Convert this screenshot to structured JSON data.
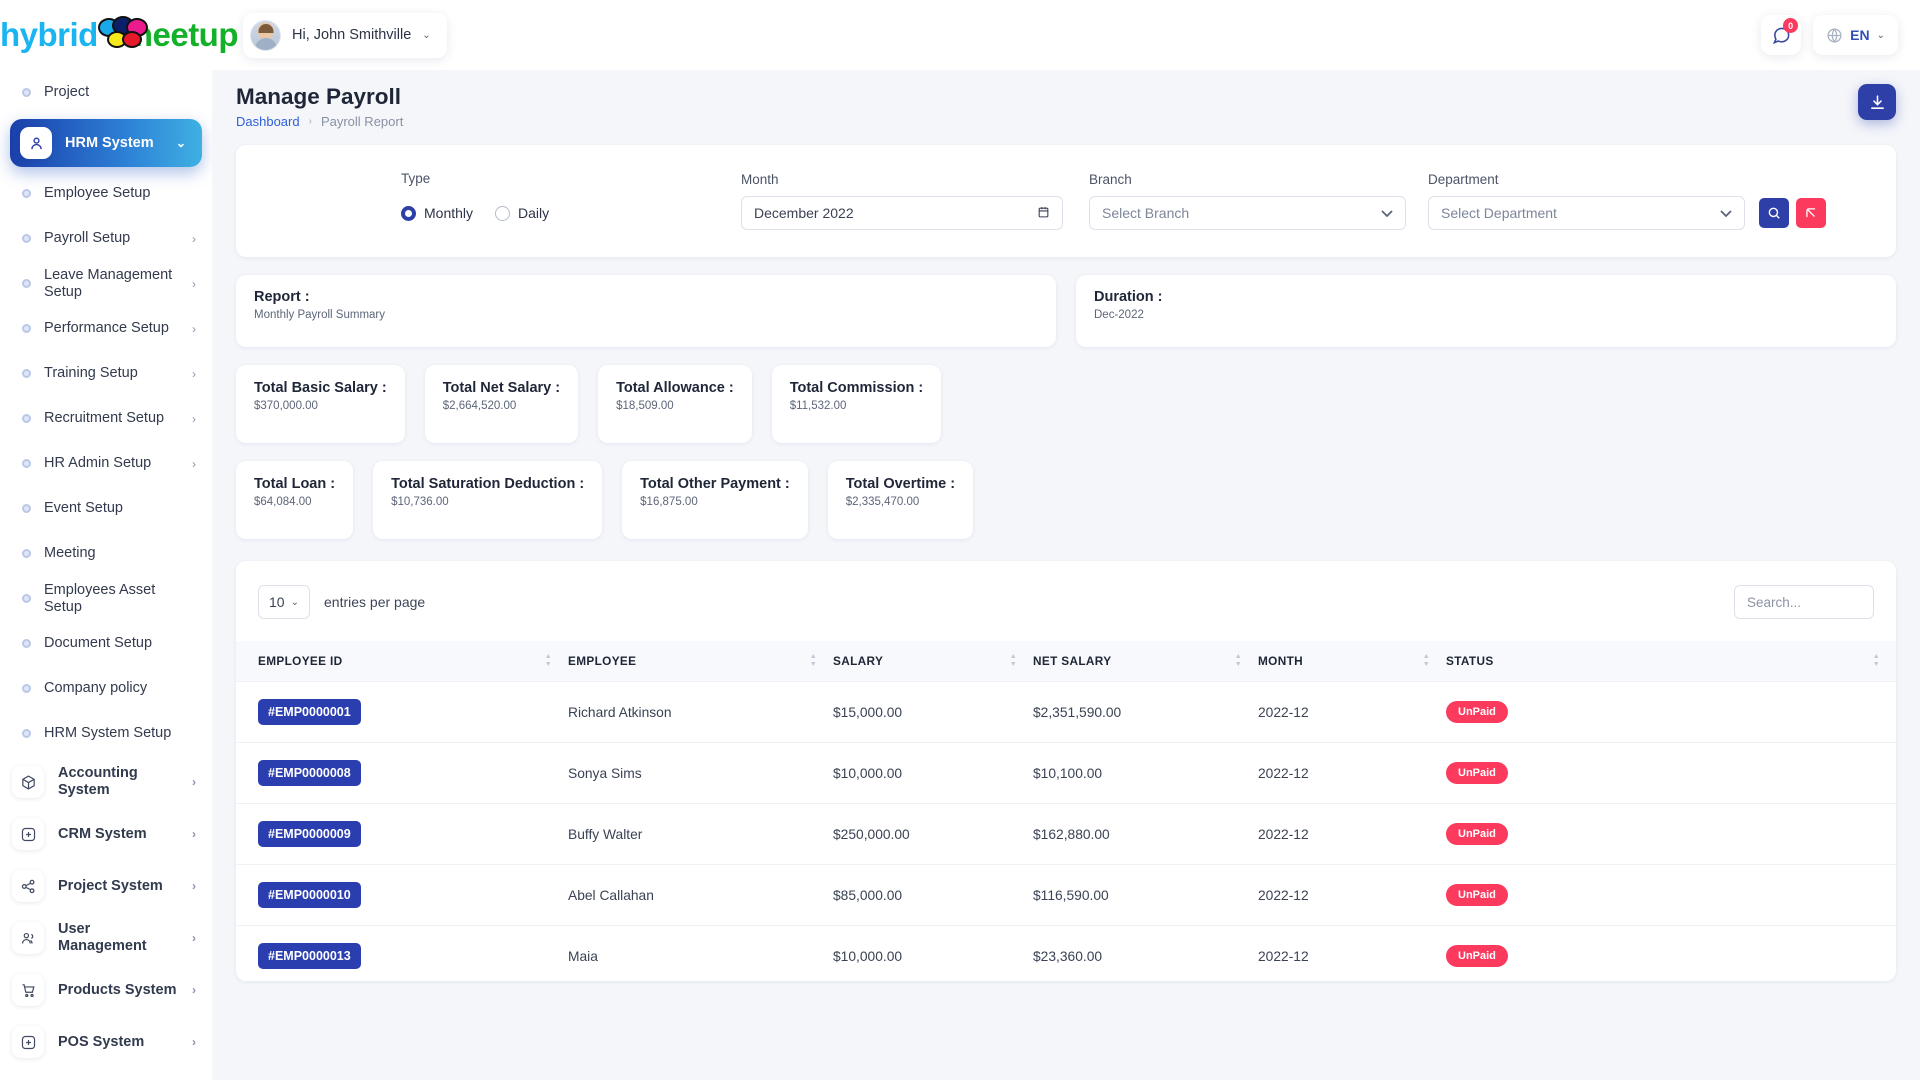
{
  "brand": {
    "word1": "hybrid",
    "word2": "meetup"
  },
  "header": {
    "greeting": "Hi, John Smithville",
    "caret": "⌄",
    "notification_count": "0",
    "language": "EN",
    "lang_caret": "⌄"
  },
  "sidebar": {
    "items": [
      {
        "label": "Project",
        "type": "sub",
        "chevron": ""
      },
      {
        "label": "HRM System",
        "type": "active",
        "chevron": "⌄",
        "icon": "user-icon"
      },
      {
        "label": "Employee Setup",
        "type": "sub",
        "chevron": ""
      },
      {
        "label": "Payroll Setup",
        "type": "sub",
        "chevron": "›"
      },
      {
        "label": "Leave Management Setup",
        "type": "sub",
        "chevron": "›"
      },
      {
        "label": "Performance Setup",
        "type": "sub",
        "chevron": "›"
      },
      {
        "label": "Training Setup",
        "type": "sub",
        "chevron": "›"
      },
      {
        "label": "Recruitment Setup",
        "type": "sub",
        "chevron": "›"
      },
      {
        "label": "HR Admin Setup",
        "type": "sub",
        "chevron": "›"
      },
      {
        "label": "Event Setup",
        "type": "sub",
        "chevron": ""
      },
      {
        "label": "Meeting",
        "type": "sub",
        "chevron": ""
      },
      {
        "label": "Employees Asset Setup",
        "type": "sub",
        "chevron": ""
      },
      {
        "label": "Document Setup",
        "type": "sub",
        "chevron": ""
      },
      {
        "label": "Company policy",
        "type": "sub",
        "chevron": ""
      },
      {
        "label": "HRM System Setup",
        "type": "sub",
        "chevron": ""
      },
      {
        "label": "Accounting System",
        "type": "group",
        "chevron": "›",
        "icon": "cube-icon"
      },
      {
        "label": "CRM System",
        "type": "group",
        "chevron": "›",
        "icon": "crm-icon"
      },
      {
        "label": "Project System",
        "type": "group",
        "chevron": "›",
        "icon": "share-icon"
      },
      {
        "label": "User Management",
        "type": "group",
        "chevron": "›",
        "icon": "users-icon"
      },
      {
        "label": "Products System",
        "type": "group",
        "chevron": "›",
        "icon": "cart-icon"
      },
      {
        "label": "POS System",
        "type": "group",
        "chevron": "›",
        "icon": "pos-icon"
      }
    ]
  },
  "page": {
    "title": "Manage Payroll",
    "breadcrumb_root": "Dashboard",
    "breadcrumb_sep": "›",
    "breadcrumb_current": "Payroll Report"
  },
  "filters": {
    "type_label": "Type",
    "type_options": [
      {
        "label": "Monthly",
        "selected": true
      },
      {
        "label": "Daily",
        "selected": false
      }
    ],
    "month_label": "Month",
    "month_value": "December 2022",
    "branch_label": "Branch",
    "branch_value": "Select Branch",
    "department_label": "Department",
    "department_value": "Select Department"
  },
  "summary": [
    {
      "title": "Report :",
      "value": "Monthly Payroll Summary"
    },
    {
      "title": "Duration :",
      "value": "Dec-2022"
    }
  ],
  "stats_row1": [
    {
      "title": "Total Basic Salary :",
      "value": "$370,000.00"
    },
    {
      "title": "Total Net Salary :",
      "value": "$2,664,520.00"
    },
    {
      "title": "Total Allowance :",
      "value": "$18,509.00"
    },
    {
      "title": "Total Commission :",
      "value": "$11,532.00"
    }
  ],
  "stats_row2": [
    {
      "title": "Total Loan :",
      "value": "$64,084.00"
    },
    {
      "title": "Total Saturation Deduction :",
      "value": "$10,736.00"
    },
    {
      "title": "Total Other Payment :",
      "value": "$16,875.00"
    },
    {
      "title": "Total Overtime :",
      "value": "$2,335,470.00"
    }
  ],
  "table": {
    "entries_value": "10",
    "entries_caret": "⌄",
    "entries_label": "entries per page",
    "search_placeholder": "Search...",
    "columns": [
      "EMPLOYEE ID",
      "EMPLOYEE",
      "SALARY",
      "NET SALARY",
      "MONTH",
      "STATUS"
    ],
    "rows": [
      {
        "id": "#EMP0000001",
        "employee": "Richard Atkinson",
        "salary": "$15,000.00",
        "net_salary": "$2,351,590.00",
        "month": "2022-12",
        "status": "UnPaid"
      },
      {
        "id": "#EMP0000008",
        "employee": "Sonya Sims",
        "salary": "$10,000.00",
        "net_salary": "$10,100.00",
        "month": "2022-12",
        "status": "UnPaid"
      },
      {
        "id": "#EMP0000009",
        "employee": "Buffy Walter",
        "salary": "$250,000.00",
        "net_salary": "$162,880.00",
        "month": "2022-12",
        "status": "UnPaid"
      },
      {
        "id": "#EMP0000010",
        "employee": "Abel Callahan",
        "salary": "$85,000.00",
        "net_salary": "$116,590.00",
        "month": "2022-12",
        "status": "UnPaid"
      },
      {
        "id": "#EMP0000013",
        "employee": "Maia",
        "salary": "$10,000.00",
        "net_salary": "$23,360.00",
        "month": "2022-12",
        "status": "UnPaid"
      }
    ]
  },
  "colors": {
    "primary": "#2f3fa8",
    "accent_pink": "#fb3a5d",
    "link": "#2f5fd8"
  }
}
